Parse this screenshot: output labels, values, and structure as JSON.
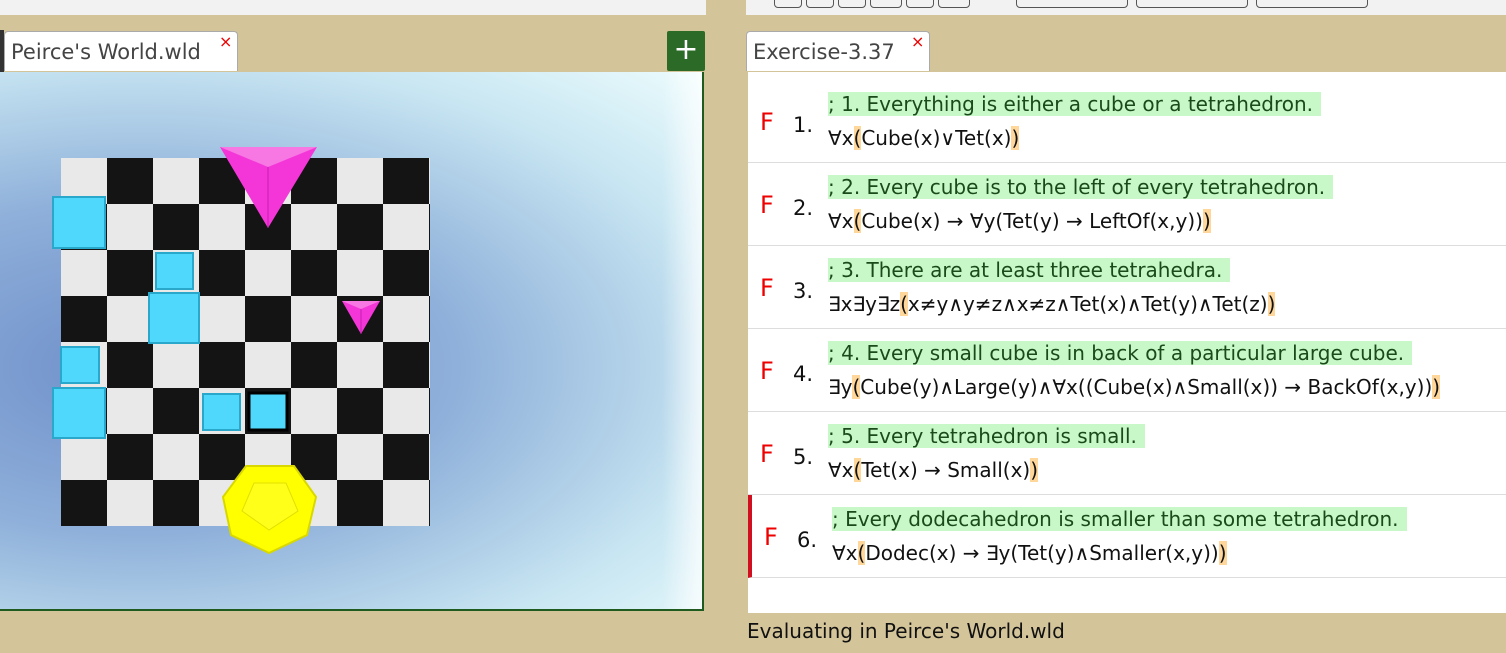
{
  "window": {
    "status": "Evaluating in Peirce's World.wld"
  },
  "tabs": {
    "world": {
      "label": "Peirce's World.wld",
      "close": "×"
    },
    "add": "+",
    "sentences": {
      "label": "Exercise-3.37",
      "close": "×"
    }
  },
  "sentences": [
    {
      "value": "F",
      "num": "1.",
      "comment": "; 1. Everything is either a cube or a tetrahedron.",
      "pre": "∀x",
      "open": "(",
      "body": "Cube(x)∨Tet(x)",
      "close": ")"
    },
    {
      "value": "F",
      "num": "2.",
      "comment": "; 2. Every cube is to the left of every tetrahedron.",
      "pre": "∀x",
      "open": "(",
      "body": "Cube(x) → ∀y(Tet(y) → LeftOf(x,y))",
      "close": ")"
    },
    {
      "value": "F",
      "num": "3.",
      "comment": "; 3. There are at least three tetrahedra.",
      "pre": "∃x∃y∃z",
      "open": "(",
      "body": "x≠y∧y≠z∧x≠z∧Tet(x)∧Tet(y)∧Tet(z)",
      "close": ")"
    },
    {
      "value": "F",
      "num": "4.",
      "comment": "; 4. Every small cube is in back of a particular large cube.",
      "pre": "∃y",
      "open": "(",
      "body": "Cube(y)∧Large(y)∧∀x((Cube(x)∧Small(x)) → BackOf(x,y))",
      "close": ")"
    },
    {
      "value": "F",
      "num": "5.",
      "comment": "; 5. Every tetrahedron is small.",
      "pre": "∀x",
      "open": "(",
      "body": "Tet(x) → Small(x)",
      "close": ")"
    },
    {
      "value": "F",
      "num": "6.",
      "comment": "; Every dodecahedron is smaller than some tetrahedron.",
      "pre": "∀x",
      "open": "(",
      "body": "Dodec(x) → ∃y(Tet(y)∧Smaller(x,y))",
      "close": ")"
    }
  ],
  "colors": {
    "cube": "#4fd8fb",
    "tet": "#f436d8",
    "dodec": "#ffff00",
    "accent": "#2c6b27",
    "false": "#e00000"
  },
  "world_objects": [
    {
      "shape": "tetrahedron",
      "size": "large"
    },
    {
      "shape": "tetrahedron",
      "size": "small"
    },
    {
      "shape": "dodecahedron",
      "size": "large"
    },
    {
      "shape": "cube",
      "size": "large"
    },
    {
      "shape": "cube",
      "size": "large"
    },
    {
      "shape": "cube",
      "size": "large"
    },
    {
      "shape": "cube",
      "size": "small"
    },
    {
      "shape": "cube",
      "size": "small"
    },
    {
      "shape": "cube",
      "size": "small"
    },
    {
      "shape": "cube",
      "size": "small",
      "selected": true
    }
  ]
}
